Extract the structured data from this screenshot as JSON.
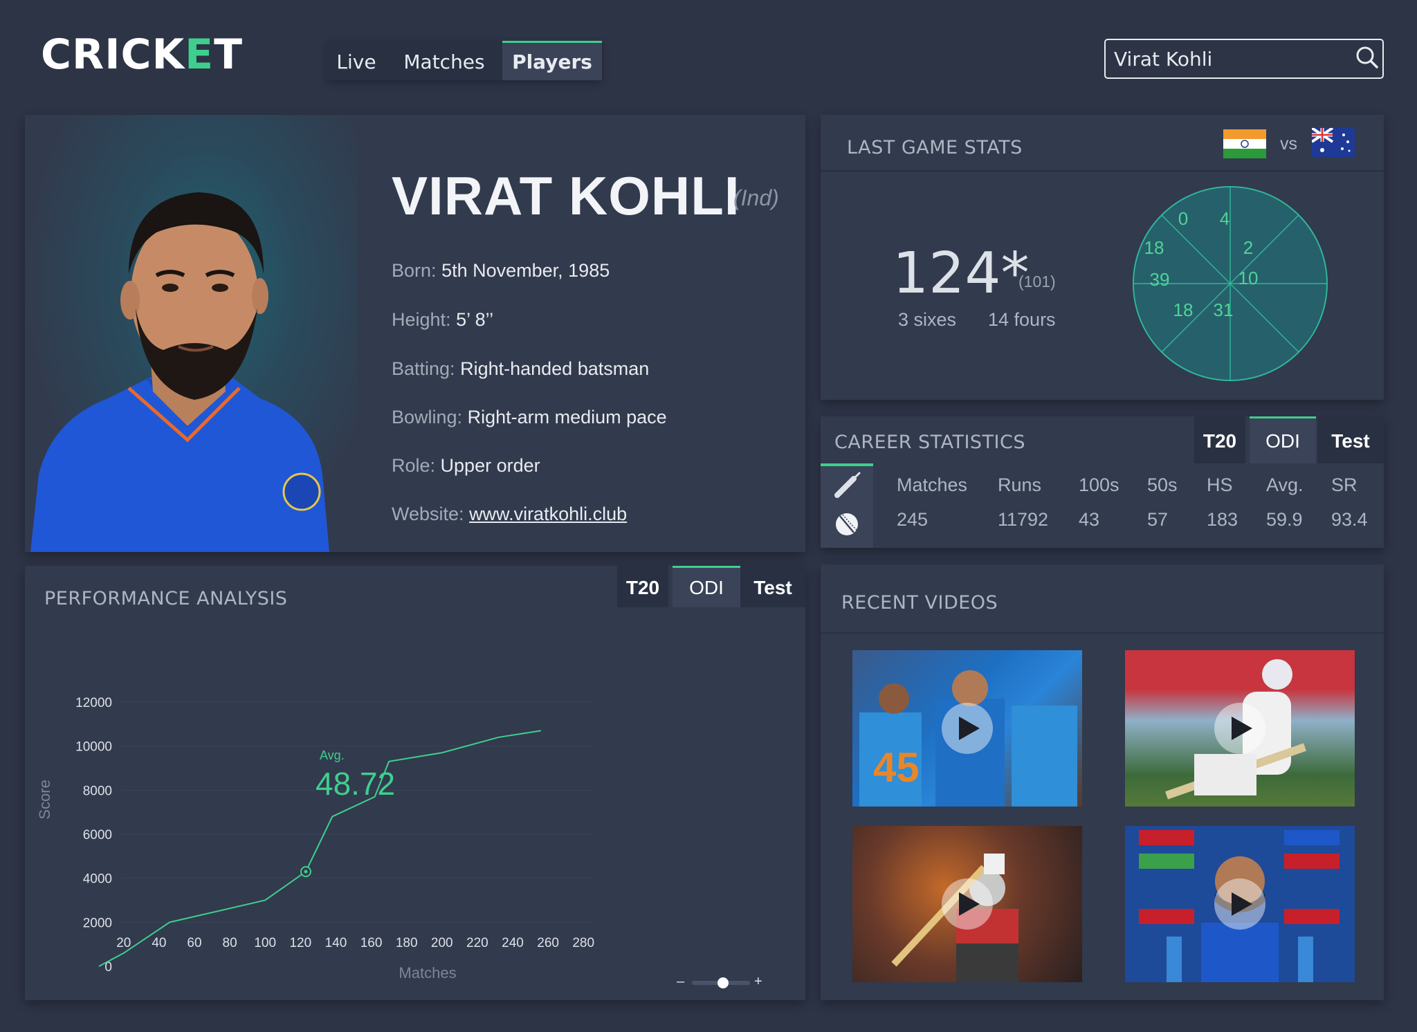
{
  "header": {
    "logo_text": "CRICKET",
    "nav": [
      {
        "label": "Live"
      },
      {
        "label": "Matches"
      },
      {
        "label": "Players",
        "active": true
      }
    ],
    "search": {
      "value": "Virat Kohli",
      "icon": "search-icon"
    }
  },
  "profile": {
    "name": "VIRAT KOHLI",
    "country": "(Ind)",
    "fields": [
      {
        "label": "Born:",
        "value": "5th November, 1985"
      },
      {
        "label": "Height:",
        "value": "5’ 8’’"
      },
      {
        "label": "Batting:",
        "value": "Right-handed batsman"
      },
      {
        "label": "Bowling:",
        "value": "Right-arm medium pace"
      },
      {
        "label": "Role:",
        "value": "Upper order"
      },
      {
        "label": "Website:",
        "value": "www.viratkohli.club"
      }
    ]
  },
  "last_game": {
    "title": "LAST GAME STATS",
    "vs": "vs",
    "score": "124*",
    "balls": "(101)",
    "sixes": "3 sixes",
    "fours": "14 fours",
    "wagon_wheel": [
      "0",
      "4",
      "2",
      "10",
      "31",
      "18",
      "39",
      "18"
    ]
  },
  "career": {
    "title": "CAREER STATISTICS",
    "tabs": [
      {
        "label": "T20"
      },
      {
        "label": "ODI",
        "active": true
      },
      {
        "label": "Test"
      }
    ],
    "headers": [
      "Matches",
      "Runs",
      "100s",
      "50s",
      "HS",
      "Avg.",
      "SR"
    ],
    "values": [
      "245",
      "11792",
      "43",
      "57",
      "183",
      "59.9",
      "93.4"
    ]
  },
  "performance": {
    "title": "PERFORMANCE ANALYSIS",
    "tabs": [
      {
        "label": "T20"
      },
      {
        "label": "ODI",
        "active": true
      },
      {
        "label": "Test"
      }
    ],
    "avg_label": "Avg.",
    "avg_value": "48.72",
    "zoom_minus": "–",
    "zoom_plus": "+",
    "zoom_level": 0.55
  },
  "chart_data": {
    "type": "line",
    "xlabel": "Matches",
    "ylabel": "Score",
    "x_ticks": [
      20,
      40,
      60,
      80,
      100,
      120,
      140,
      160,
      180,
      200,
      220,
      240,
      260,
      280
    ],
    "y_ticks": [
      0,
      2000,
      4000,
      6000,
      8000,
      10000,
      12000
    ],
    "xlim": [
      6,
      285
    ],
    "ylim": [
      0,
      12000
    ],
    "grid": true,
    "series": [
      {
        "x": [
          6,
          20,
          46,
          100,
          123,
          138,
          162,
          170,
          200,
          232,
          256
        ],
        "y": [
          0,
          600,
          2000,
          3000,
          4300,
          6800,
          7700,
          9300,
          9700,
          10400,
          10700
        ]
      }
    ],
    "highlight": {
      "x": 123,
      "y": 4300
    }
  },
  "videos": {
    "title": "RECENT VIDEOS",
    "items": [
      {
        "name": "video-1"
      },
      {
        "name": "video-2"
      },
      {
        "name": "video-3"
      },
      {
        "name": "video-4"
      }
    ]
  },
  "colors": {
    "background": "#2d3446",
    "panel": "#323a4d",
    "accent": "#3ecf8e",
    "text": "#e8ebf0",
    "muted": "#aeb5c3"
  }
}
